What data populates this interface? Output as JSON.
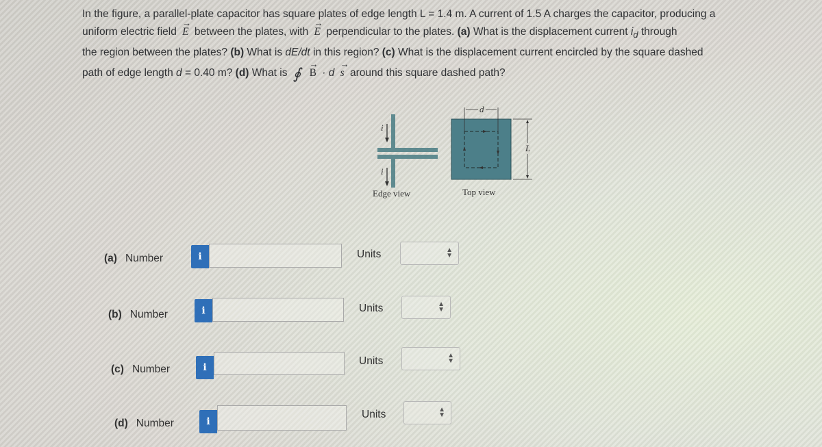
{
  "question": {
    "line1": "In the figure, a parallel-plate capacitor has square plates of edge length L = 1.4 m. A current of 1.5 A charges the capacitor, producing a",
    "line2_a": "uniform electric field",
    "line2_vecE1": "E",
    "line2_b": "between the plates, with",
    "line2_vecE2": "E",
    "line2_c": "perpendicular to the plates.",
    "line2_partA": "(a)",
    "line2_d": "What is the displacement current",
    "line2_id": "i",
    "line2_id_sub": "d",
    "line2_e": "through",
    "line3_a": "the region between the plates?",
    "line3_partB": "(b)",
    "line3_b": "What is",
    "line3_dEdt": "dE/dt",
    "line3_c": "in this region?",
    "line3_partC": "(c)",
    "line3_d": "What is the displacement current encircled by the square dashed",
    "line4_a": "path of edge length",
    "line4_d": "d",
    "line4_b": "= 0.40 m?",
    "line4_partD": "(d)",
    "line4_c": "What is",
    "line4_oint": "∮",
    "line4_B": "B",
    "line4_dot": "· d",
    "line4_s": "s",
    "line4_e": "around this square dashed path?"
  },
  "figure": {
    "edge_view_caption": "Edge view",
    "top_view_caption": "Top view",
    "current_label": "i",
    "d_label": "d",
    "L_label": "L"
  },
  "answers": [
    {
      "part": "(a)",
      "label": "Number",
      "info": "i",
      "value": "",
      "units_label": "Units",
      "units_value": ""
    },
    {
      "part": "(b)",
      "label": "Number",
      "info": "i",
      "value": "",
      "units_label": "Units",
      "units_value": ""
    },
    {
      "part": "(c)",
      "label": "Number",
      "info": "i",
      "value": "",
      "units_label": "Units",
      "units_value": ""
    },
    {
      "part": "(d)",
      "label": "Number",
      "info": "i",
      "value": "",
      "units_label": "Units",
      "units_value": ""
    }
  ]
}
